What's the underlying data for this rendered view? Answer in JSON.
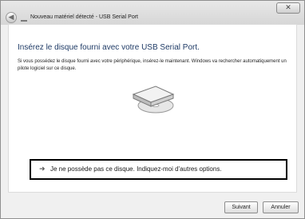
{
  "window": {
    "title": "Nouveau matériel détecté - USB Serial Port",
    "close_glyph": "✕",
    "back_glyph": "◀"
  },
  "main": {
    "heading": "Insérez le disque fourni avec votre USB Serial Port.",
    "description": "Si vous possédez le disque fourni avec votre périphérique, insérez-le maintenant. Windows va rechercher automatiquement un pilote logiciel sur ce disque.",
    "device_icon": "cd-drive-icon",
    "option_arrow": "➜",
    "option_text": "Je ne possède pas ce disque. Indiquez-moi d'autres options."
  },
  "footer": {
    "next_label": "Suivant",
    "cancel_label": "Annuler"
  }
}
